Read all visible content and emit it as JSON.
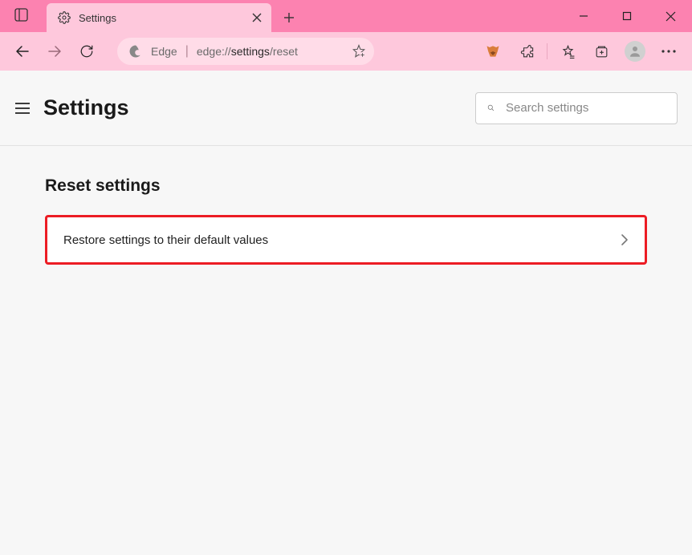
{
  "tab": {
    "title": "Settings"
  },
  "addressbar": {
    "label": "Edge",
    "url_prefix": "edge://",
    "url_bold": "settings",
    "url_suffix": "/reset"
  },
  "page": {
    "title": "Settings",
    "search_placeholder": "Search settings"
  },
  "section": {
    "title": "Reset settings",
    "row_label": "Restore settings to their default values"
  }
}
